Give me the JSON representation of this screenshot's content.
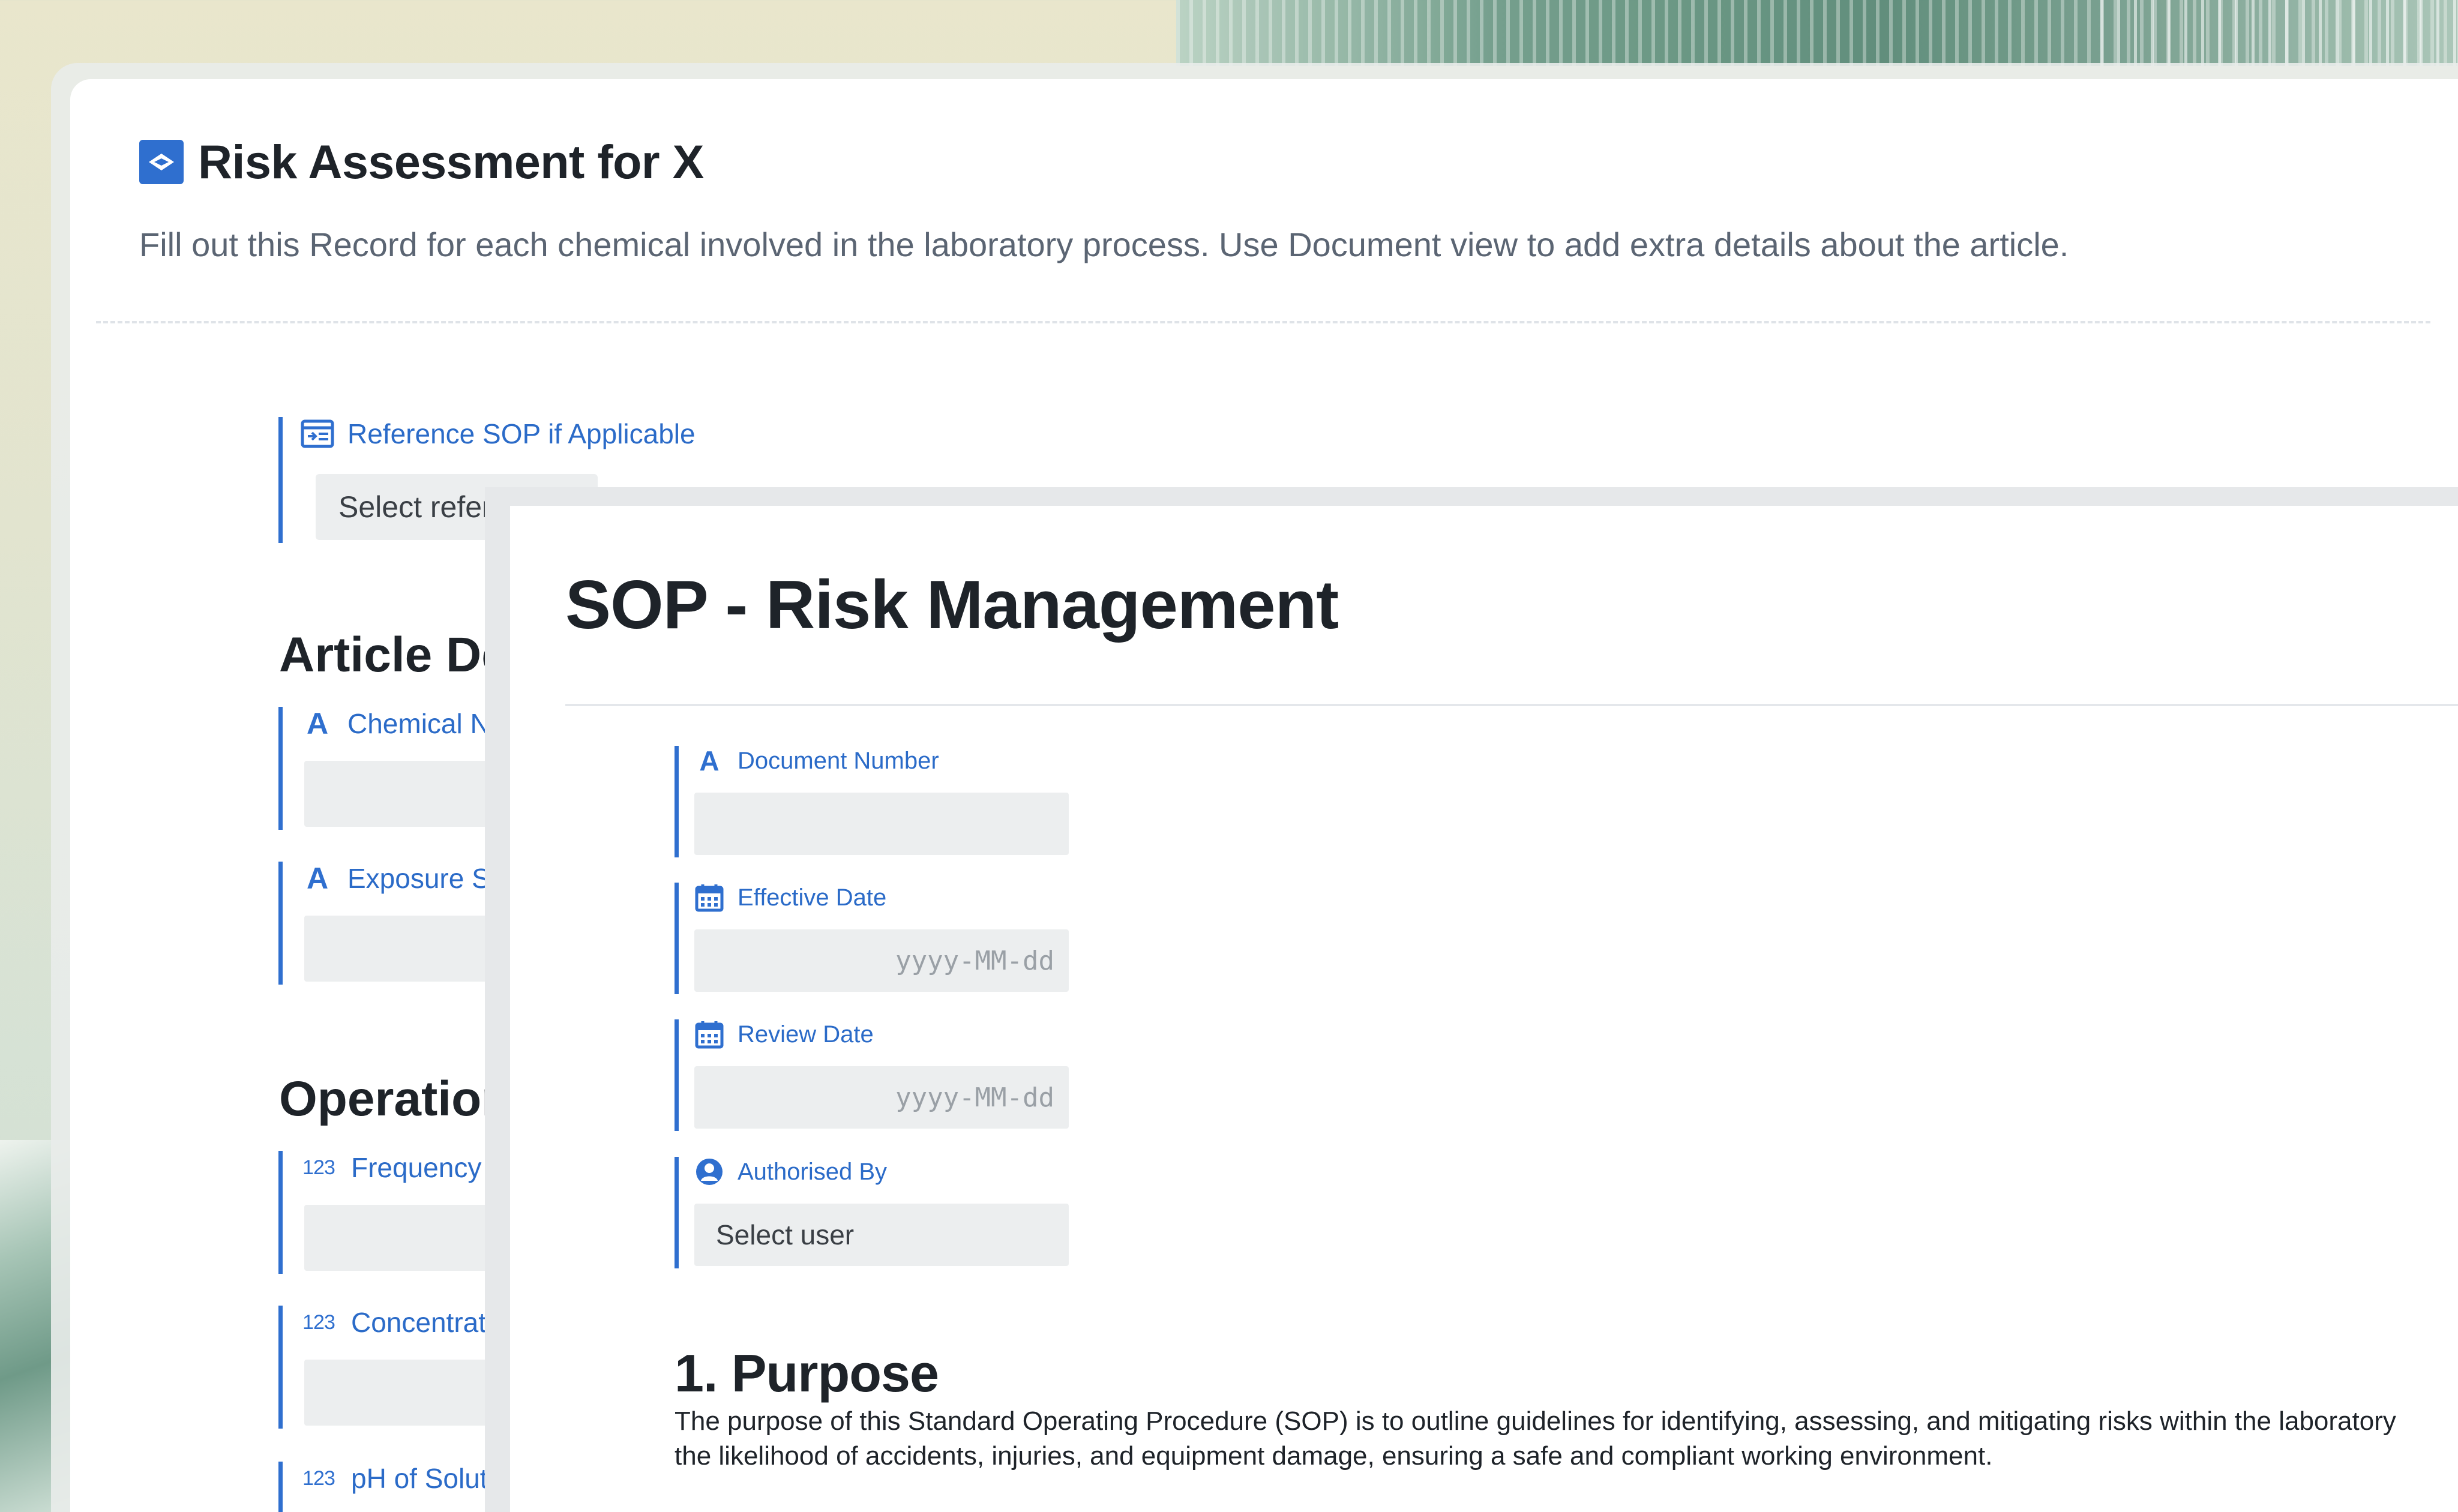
{
  "risk_assessment": {
    "title": "Risk Assessment for X",
    "description": "Fill out this Record for each chemical involved in the laboratory process. Use Document view to add extra details about the article.",
    "reference_field": {
      "label": "Reference SOP if Applicable",
      "placeholder": "Select reference",
      "icon": "reference-icon"
    },
    "sections": [
      {
        "title": "Article Details",
        "fields": [
          {
            "label": "Chemical Name",
            "icon": "text-field-icon"
          },
          {
            "label": "Exposure Scenario",
            "icon": "text-field-icon"
          }
        ]
      },
      {
        "title": "Operational Details",
        "fields": [
          {
            "label": "Frequency of Use",
            "icon": "number-field-icon"
          },
          {
            "label": "Concentration",
            "icon": "number-field-icon"
          },
          {
            "label": "pH of Solution",
            "icon": "number-field-icon"
          }
        ]
      }
    ],
    "number_icon_text": "123",
    "text_icon_text": "A"
  },
  "sop": {
    "title": "SOP - Risk Management",
    "fields": [
      {
        "label": "Document Number",
        "value": "",
        "icon": "text-field-icon"
      },
      {
        "label": "Effective Date",
        "placeholder": "yyyy-MM-dd",
        "icon": "calendar-icon"
      },
      {
        "label": "Review Date",
        "placeholder": "yyyy-MM-dd",
        "icon": "calendar-icon"
      },
      {
        "label": "Authorised By",
        "placeholder": "Select user",
        "icon": "user-icon"
      }
    ],
    "purpose": {
      "heading": "1. Purpose",
      "line1": "The purpose of this Standard Operating Procedure (SOP) is to outline guidelines for identifying, assessing, and mitigating risks within the laboratory",
      "line2": "the likelihood of accidents, injuries, and equipment damage, ensuring a safe and compliant working environment."
    }
  },
  "colors": {
    "accent": "#2f6fcf",
    "label": "#2b6bc8",
    "text": "#1e2329",
    "muted": "#5b6573",
    "field_bg": "#eceeef"
  }
}
